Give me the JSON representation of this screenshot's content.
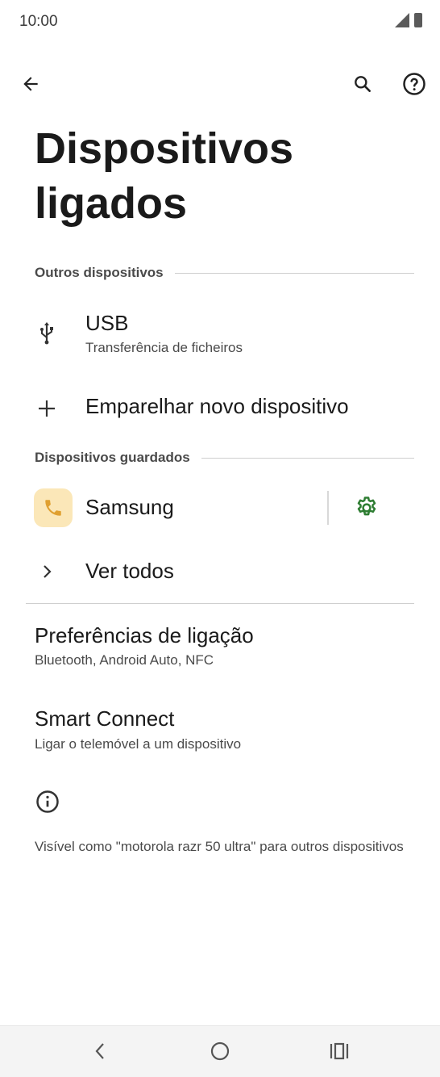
{
  "status_bar": {
    "time": "10:00"
  },
  "header": {
    "title": "Dispositivos ligados"
  },
  "sections": {
    "other_devices": {
      "label": "Outros dispositivos",
      "usb": {
        "title": "USB",
        "subtitle": "Transferência de ficheiros",
        "icon": "usb-icon"
      },
      "pair": {
        "title": "Emparelhar novo dispositivo",
        "icon": "plus-icon"
      }
    },
    "saved_devices": {
      "label": "Dispositivos guardados",
      "device": {
        "title": "Samsung",
        "icon": "phone-icon",
        "settings_icon": "gear-icon"
      },
      "see_all": {
        "title": "Ver todos",
        "icon": "chevron-right-icon"
      }
    }
  },
  "preferences": {
    "connection": {
      "title": "Preferências de ligação",
      "subtitle": "Bluetooth, Android Auto, NFC"
    },
    "smart_connect": {
      "title": "Smart Connect",
      "subtitle": "Ligar o telemóvel a um dispositivo"
    }
  },
  "footer": {
    "text": "Visível como \"motorola razr 50 ultra\" para outros dispositivos"
  },
  "colors": {
    "accent_green": "#2e7d32",
    "phone_badge_bg": "#fbe7b8",
    "phone_icon": "#e0a030"
  }
}
